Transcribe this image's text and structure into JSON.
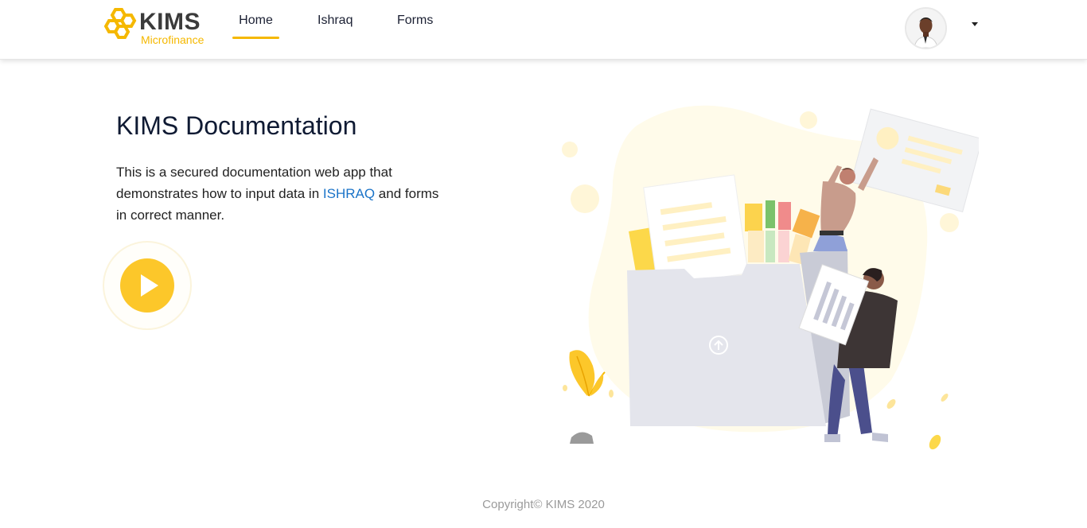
{
  "header": {
    "logo_text": "KIMS",
    "logo_subtext": "Microfinance",
    "nav": [
      {
        "label": "Home",
        "active": true
      },
      {
        "label": "Ishraq",
        "active": false
      },
      {
        "label": "Forms",
        "active": false
      }
    ]
  },
  "main": {
    "title": "KIMS Documentation",
    "description_before": "This is a secured documentation web app that demonstrates how to input data in ",
    "description_link": "ISHRAQ",
    "description_after": " and forms in correct manner."
  },
  "footer": {
    "copyright": "Copyright© KIMS 2020"
  },
  "colors": {
    "accent": "#f5b800",
    "play": "#fcc72a",
    "link": "#1a73c8",
    "footer_text": "#9a9a9a"
  }
}
